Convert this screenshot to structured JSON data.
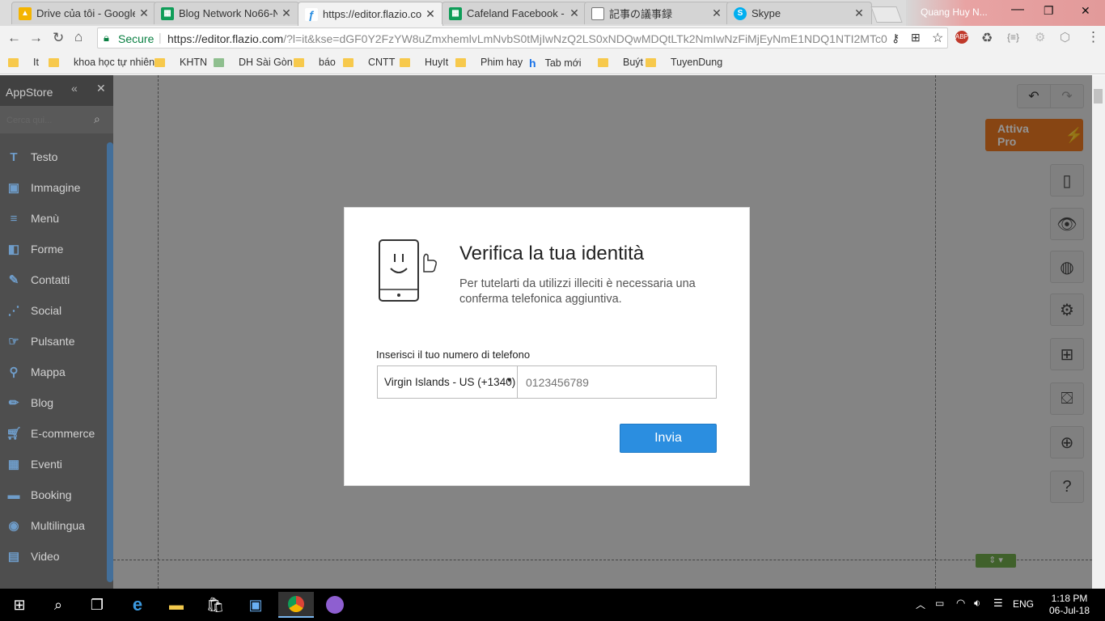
{
  "tabs": [
    {
      "label": "Drive của tôi - Google",
      "icon": "google-drive-icon",
      "color": "#f4b400"
    },
    {
      "label": "Blog Network No66-N",
      "icon": "sheets-icon",
      "color": "#0f9d58"
    },
    {
      "label": "https://editor.flazio.co",
      "icon": "flazio-icon",
      "color": "#2b8ee0"
    },
    {
      "label": "Cafeland Facebook - G",
      "icon": "sheets-icon",
      "color": "#0f9d58"
    },
    {
      "label": "記事の議事録",
      "icon": "document-icon",
      "color": "#777777"
    },
    {
      "label": "Skype",
      "icon": "skype-icon",
      "color": "#00aff0"
    }
  ],
  "profile_name": "Quang Huy N...",
  "toolbar": {
    "secure_label": "Secure",
    "url_main": "https://editor.flazio.com",
    "url_rest": "/?l=it&kse=dGF0Y2FzYW8uZmxhemlvLmNvbS0tMjIwNzQ2LS0xNDQwMDQtLTk2NmIwNzFiMjEyNmE1NDQ1NTI2MTc0..."
  },
  "bookmarks": [
    {
      "label": "It"
    },
    {
      "label": "khoa học tự nhiên"
    },
    {
      "label": "KHTN"
    },
    {
      "label": "DH Sài Gòn"
    },
    {
      "label": "báo"
    },
    {
      "label": "CNTT"
    },
    {
      "label": "HuyIt"
    },
    {
      "label": "Phim hay"
    },
    {
      "label": "Tab mới"
    },
    {
      "label": "Buýt"
    },
    {
      "label": "TuyenDung"
    }
  ],
  "sidebar": {
    "title": "AppStore",
    "search_placeholder": "Cerca qui...",
    "items": [
      {
        "label": "Testo",
        "icon": "text-icon"
      },
      {
        "label": "Immagine",
        "icon": "image-icon"
      },
      {
        "label": "Menù",
        "icon": "menu-icon"
      },
      {
        "label": "Forme",
        "icon": "shapes-icon"
      },
      {
        "label": "Contatti",
        "icon": "contacts-icon"
      },
      {
        "label": "Social",
        "icon": "share-icon"
      },
      {
        "label": "Pulsante",
        "icon": "button-icon"
      },
      {
        "label": "Mappa",
        "icon": "map-pin-icon"
      },
      {
        "label": "Blog",
        "icon": "pencil-icon"
      },
      {
        "label": "E-commerce",
        "icon": "cart-icon"
      },
      {
        "label": "Eventi",
        "icon": "calendar-icon"
      },
      {
        "label": "Booking",
        "icon": "bed-icon"
      },
      {
        "label": "Multilingua",
        "icon": "globe-icon"
      },
      {
        "label": "Video",
        "icon": "film-icon"
      }
    ]
  },
  "right_tools": {
    "attiva_pro": "Attiva Pro"
  },
  "modal": {
    "title": "Verifica la tua identità",
    "description": "Per tutelarti da utilizzi illeciti è necessaria una conferma telefonica aggiuntiva.",
    "phone_label": "Inserisci il tuo numero di telefono",
    "country_value": "Virgin Islands - US (+1340)",
    "phone_placeholder": "0123456789",
    "submit_label": "Invia"
  },
  "taskbar": {
    "language": "ENG",
    "time": "1:18 PM",
    "date": "06-Jul-18"
  }
}
